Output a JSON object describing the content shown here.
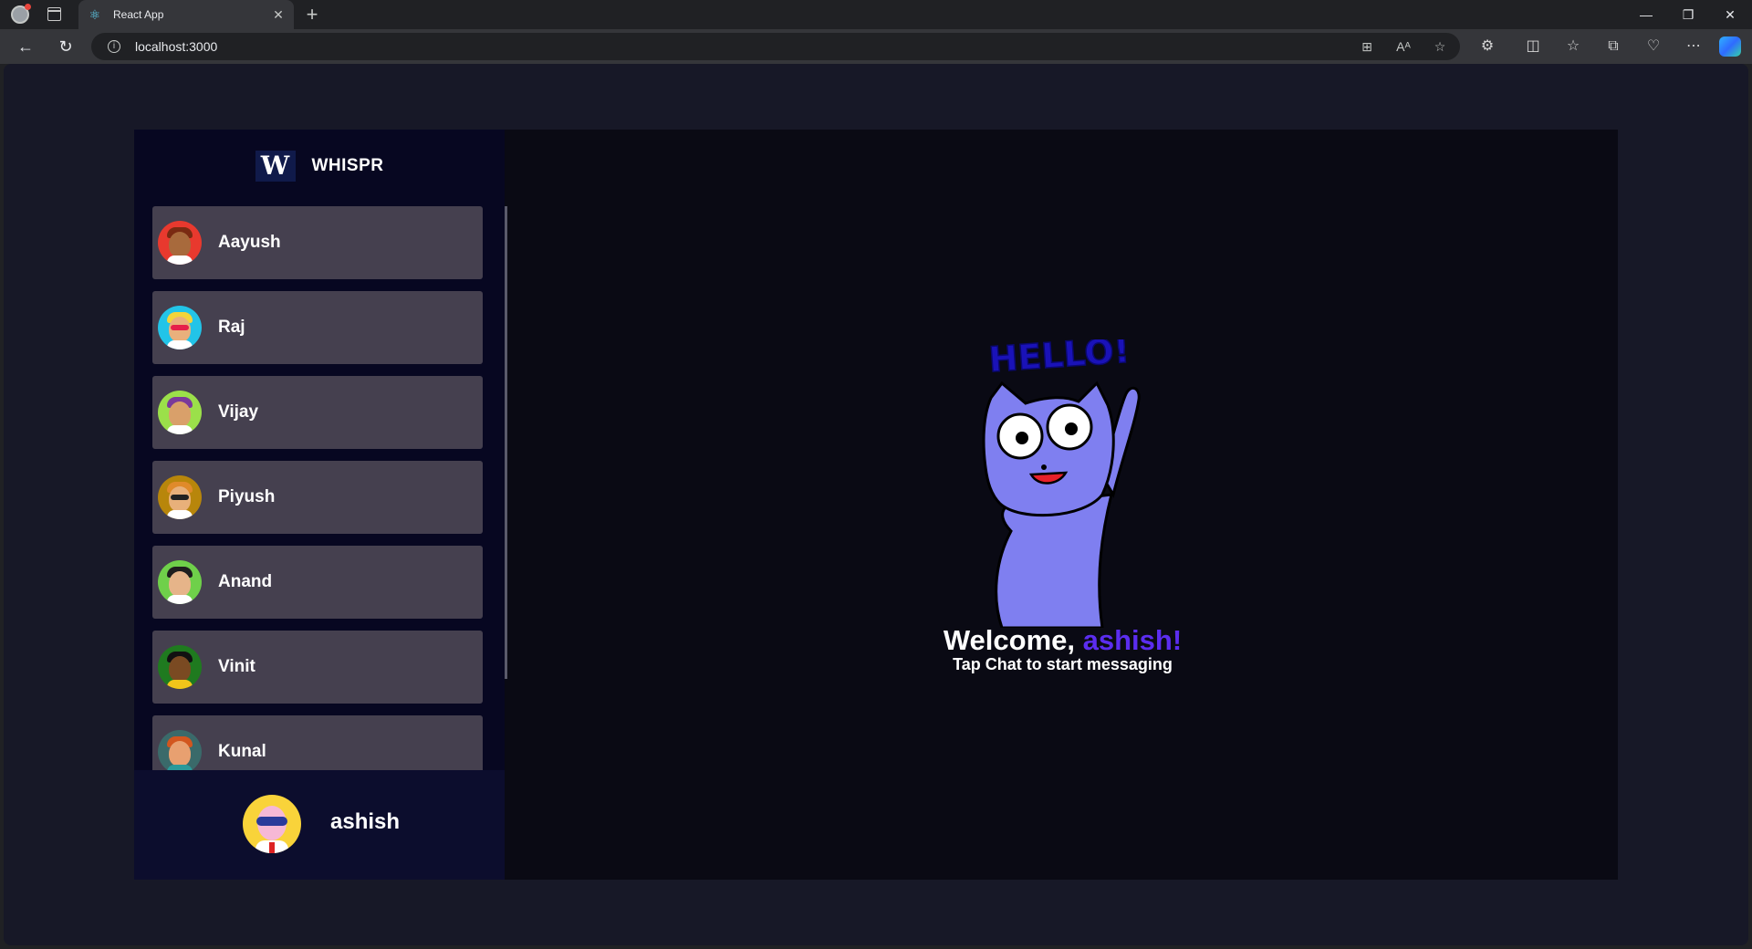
{
  "browser": {
    "tab_title": "React App",
    "url": "localhost:3000"
  },
  "app": {
    "brand_letter": "W",
    "brand_name": "WHISPR",
    "contacts": [
      {
        "name": "Aayush",
        "avatar_bg": "#e8392e",
        "face": "#a86a3c",
        "hair": "#7a2a12",
        "accent": ""
      },
      {
        "name": "Raj",
        "avatar_bg": "#22c4e8",
        "face": "#e9b07c",
        "hair": "#f4d43a",
        "accent": "#e6204a"
      },
      {
        "name": "Vijay",
        "avatar_bg": "#9be04a",
        "face": "#d9a06a",
        "hair": "#7a3a9a",
        "accent": ""
      },
      {
        "name": "Piyush",
        "avatar_bg": "#b8860b",
        "face": "#e8b07a",
        "hair": "#e08a2a",
        "accent": "#222222"
      },
      {
        "name": "Anand",
        "avatar_bg": "#6fd04a",
        "face": "#e6b489",
        "hair": "#1e1e1e",
        "accent": ""
      },
      {
        "name": "Vinit",
        "avatar_bg": "#1f7a1f",
        "face": "#7a4a22",
        "hair": "#111111",
        "accent": ""
      },
      {
        "name": "Kunal",
        "avatar_bg": "#3a6a6a",
        "face": "#e8a070",
        "hair": "#d2561e",
        "accent": ""
      }
    ],
    "current_user": "ashish",
    "welcome": {
      "hello_text": "HELLO!",
      "greeting": "Welcome, ",
      "username": "ashish!",
      "subtitle": "Tap Chat to start messaging"
    }
  }
}
